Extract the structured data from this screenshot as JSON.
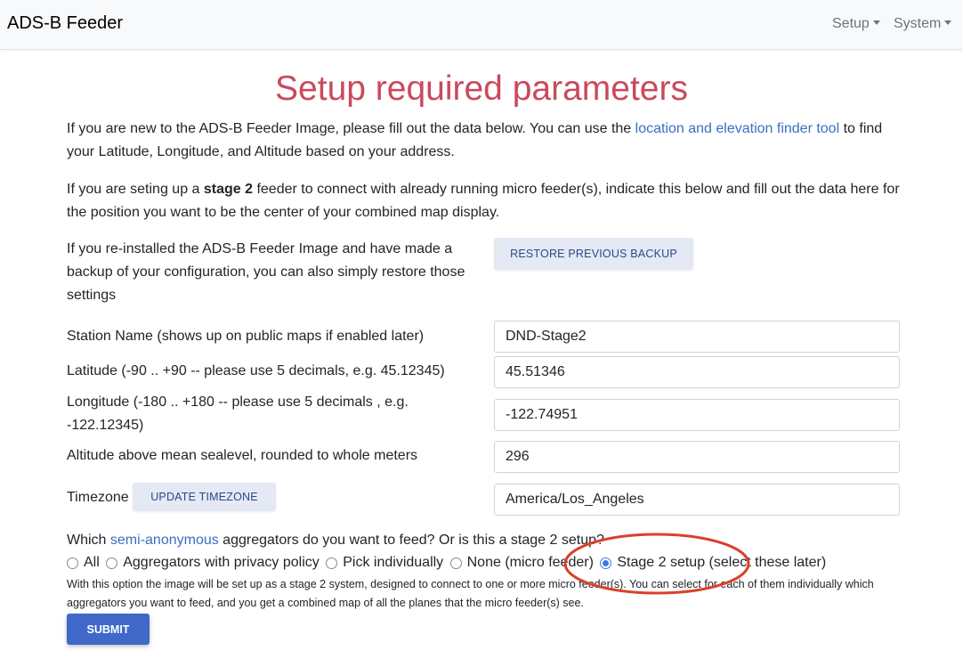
{
  "navbar": {
    "brand": "ADS-B Feeder",
    "menus": [
      {
        "label": "Setup"
      },
      {
        "label": "System"
      }
    ]
  },
  "page": {
    "title": "Setup required parameters",
    "intro": {
      "before_link": "If you are new to the ADS-B Feeder Image, please fill out the data below. You can use the ",
      "link_text": "location and elevation finder tool",
      "after_link": " to find your Latitude, Longitude, and Altitude based on your address."
    },
    "stage2_note": {
      "before_bold": "If you are seting up a ",
      "bold": "stage 2",
      "after_bold": " feeder to connect with already running micro feeder(s), indicate this below and fill out the data here for the position you want to be the center of your combined map display."
    },
    "restore_note": "If you re-installed the ADS-B Feeder Image and have made a backup of your configuration, you can also simply restore those settings",
    "restore_button": "Restore previous backup"
  },
  "form": {
    "station_name": {
      "label": "Station Name (shows up on public maps if enabled later)",
      "value": "DND-Stage2"
    },
    "latitude": {
      "label": "Latitude (-90 .. +90 -- please use 5 decimals, e.g. 45.12345)",
      "value": "45.51346"
    },
    "longitude": {
      "label": "Longitude (-180 .. +180 -- please use 5 decimals , e.g. -122.12345)",
      "value": "-122.74951"
    },
    "altitude": {
      "label": "Altitude above mean sealevel, rounded to whole meters",
      "value": "296"
    },
    "timezone": {
      "label": "Timezone",
      "button": "Update Timezone",
      "value": "America/Los_Angeles"
    }
  },
  "aggregators": {
    "question_before": "Which ",
    "question_link": "semi-anonymous",
    "question_after": " aggregators do you want to feed? Or is this a stage 2 setup?",
    "options": [
      {
        "label": "All",
        "checked": false
      },
      {
        "label": "Aggregators with privacy policy",
        "checked": false
      },
      {
        "label": "Pick individually",
        "checked": false
      },
      {
        "label": "None (micro feeder)",
        "checked": false
      },
      {
        "label": "Stage 2 setup (select these later)",
        "checked": true
      }
    ],
    "help": "With this option the image will be set up as a stage 2 system, designed to connect to one or more micro feeder(s). You can select for each of them individually which aggregators you want to feed, and you get a combined map of all the planes that the micro feeder(s) see."
  },
  "submit_label": "Submit",
  "colors": {
    "title": "#c94a5c",
    "link": "#3a6fc4",
    "primary_button": "#3f68c9",
    "secondary_button": "#e4e9f4",
    "annotation": "#d9402b"
  }
}
